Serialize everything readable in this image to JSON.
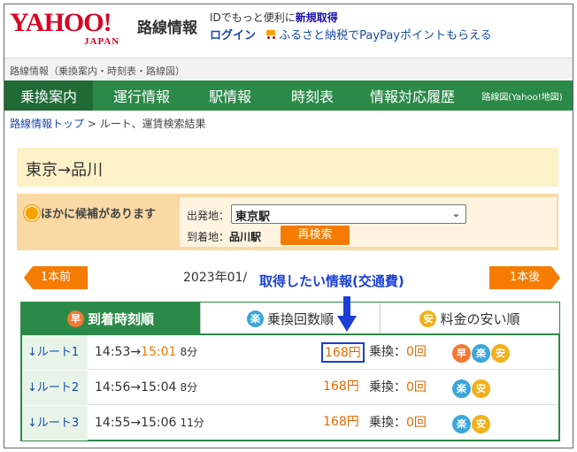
{
  "header": {
    "logo_main": "YAHOO!",
    "logo_sub": "JAPAN",
    "service": "路線情報",
    "id_promo_prefix": "IDでもっと便利に",
    "id_promo_link": "新規取得",
    "login": "ログイン",
    "furusato": "ふるさと納税でPayPayポイントもらえる"
  },
  "graybar": "路線情報（乗換案内・時刻表・路線図）",
  "nav": [
    "乗換案内",
    "運行情報",
    "駅情報",
    "時刻表",
    "情報対応履歴",
    "路線図(Yahoo!地図)"
  ],
  "breadcrumb": {
    "link": "路線情報トップ",
    "sep": " > ",
    "current": "ルート、運賃検索結果"
  },
  "title": "東京→品川",
  "candidates": {
    "label": "ほかに候補があります",
    "from_label": "出発地：",
    "from_value": "東京駅",
    "to_label": "到着地：",
    "to_value": "品川駅",
    "research": "再検索"
  },
  "pager": {
    "prev": "1本前",
    "next": "1本後",
    "date": "2023年01/"
  },
  "annotation": "取得したい情報(交通費)",
  "tabs": [
    {
      "badge": "早",
      "label": "到着時刻順"
    },
    {
      "badge": "楽",
      "label": "乗換回数順"
    },
    {
      "badge": "安",
      "label": "料金の安い順"
    }
  ],
  "routes": [
    {
      "name": "ルート1",
      "dep": "14:53→",
      "arr": "15:01",
      "dur": "8分",
      "fare": "168円",
      "transfer_label": "乗換：",
      "transfer_count": "0回",
      "icons": [
        "早",
        "楽",
        "安"
      ]
    },
    {
      "name": "ルート2",
      "dep": "14:56→",
      "arr": "15:04",
      "dur": "8分",
      "fare": "168円",
      "transfer_label": "乗換：",
      "transfer_count": "0回",
      "icons": [
        "楽",
        "安"
      ]
    },
    {
      "name": "ルート3",
      "dep": "14:55→",
      "arr": "15:06",
      "dur": "11分",
      "fare": "168円",
      "transfer_label": "乗換：",
      "transfer_count": "0回",
      "icons": [
        "楽",
        "安"
      ]
    }
  ],
  "colors": {
    "brand_red": "#d90024",
    "nav_green": "#2c8a48",
    "accent_orange": "#f57c00",
    "annotation_blue": "#1a3fd6"
  }
}
